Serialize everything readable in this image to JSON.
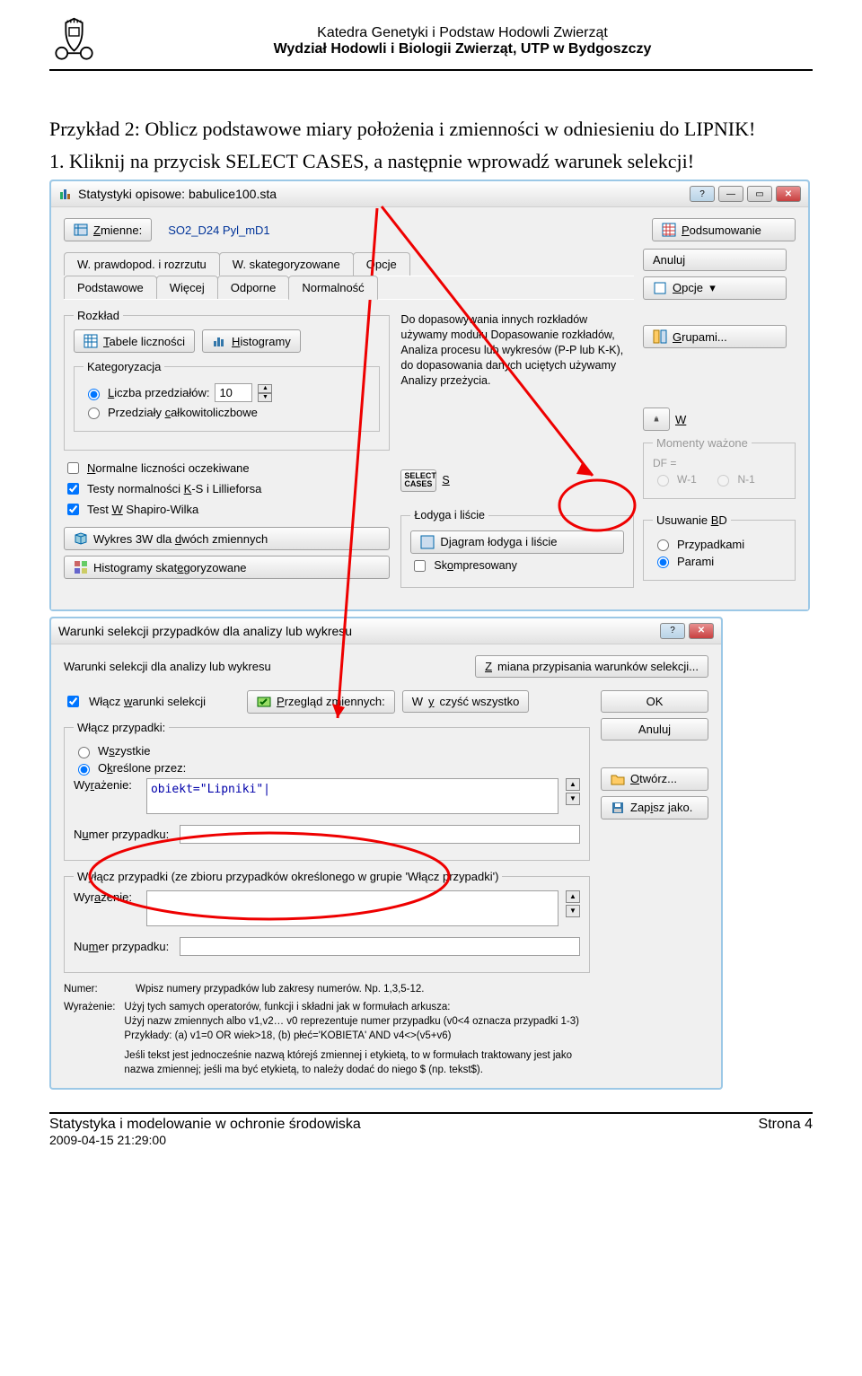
{
  "header": {
    "dept": "Katedra Genetyki i Podstaw Hodowli Zwierząt",
    "faculty": "Wydział Hodowli i Biologii Zwierząt, UTP w Bydgoszczy"
  },
  "body": {
    "p1": "Przykład 2: Oblicz podstawowe miary położenia i zmienności w odniesieniu do LIPNIK!",
    "p2": "1. Kliknij na przycisk SELECT CASES, a następnie wprowadź warunek selekcji!"
  },
  "dialog1": {
    "title": "Statystyki opisowe: babulice100.sta",
    "vars_label": "Zmienne:",
    "vars_value": "SO2_D24 Pyl_mD1",
    "btn_summary": "Podsumowanie",
    "btn_cancel": "Anuluj",
    "btn_options": "Opcje",
    "btn_groups": "Grupami...",
    "tabs_row1": [
      "W. prawdopod. i rozrzutu",
      "W. skategoryzowane",
      "Opcje"
    ],
    "tabs_row2": [
      "Podstawowe",
      "Więcej",
      "Odporne",
      "Normalność"
    ],
    "distribution": {
      "legend": "Rozkład",
      "btn_tables": "Tabele liczności",
      "btn_hist": "Histogramy"
    },
    "categorization": {
      "legend": "Kategoryzacja",
      "opt_intervals": "Liczba przedziałów:",
      "intervals_value": "10",
      "opt_integer": "Przedziały całkowitoliczbowe"
    },
    "chk_expected": "Normalne liczności oczekiwane",
    "chk_ks": "Testy normalności K-S i Lillieforsa",
    "chk_sw": "Test W Shapiro-Wilka",
    "btn_3dplot": "Wykres 3W  dla dwóch zmiennych",
    "btn_cathist": "Histogramy skategoryzowane",
    "info_text": "Do dopasowywania innych rozkładów używamy modułu Dopasowanie rozkładów, Analiza procesu lub wykresów (P-P lub K-K), do dopasowania danych uciętych używamy Analizy przeżycia.",
    "stem": {
      "legend": "Łodyga i liście",
      "btn_diagram": "Djagram łodyga i liście",
      "chk_compressed": "Skompresowany"
    },
    "select_cases_label": "SELECT CASES",
    "select_cases_s": "S",
    "btn_w": "W",
    "weights_legend": "Momenty ważone",
    "df_legend": "DF =",
    "df_opt1": "W-1",
    "df_opt2": "N-1",
    "bd": {
      "legend": "Usuwanie BD",
      "opt_cases": "Przypadkami",
      "opt_pairs": "Parami"
    }
  },
  "dialog2": {
    "title": "Warunki selekcji przypadków dla analizy lub wykresu",
    "subtitle": "Warunki selekcji dla analizy lub wykresu",
    "btn_change": "Zmiana przypisania warunków selekcji...",
    "chk_enable": "Włącz warunki selekcji",
    "btn_preview_label": "Przegląd zmiennych:",
    "btn_clear": "Wyczyść wszystko",
    "btn_ok": "OK",
    "btn_cancel": "Anuluj",
    "btn_open": "Otwórz...",
    "btn_save": "Zapisz jako.",
    "include": {
      "legend": "Włącz przypadki:",
      "opt_all": "Wszystkie",
      "opt_specific": "Określone przez:",
      "lbl_expr": "Wyrażenie:",
      "expr_value": "obiekt=\"Lipniki\"|",
      "lbl_casenum": "Numer przypadku:"
    },
    "exclude": {
      "legend": "Wyłącz przypadki (ze zbioru przypadków określonego w grupie 'Włącz przypadki')",
      "lbl_expr": "Wyrażenie:",
      "lbl_casenum": "Numer przypadku:"
    },
    "help": {
      "lbl_num": "Numer:",
      "txt_num": "Wpisz numery przypadków lub zakresy numerów. Np. 1,3,5-12.",
      "lbl_expr": "Wyrażenie:",
      "txt_expr1": "Użyj tych samych operatorów, funkcji i składni jak w formułach arkusza:",
      "txt_expr2": "Użyj nazw zmiennych albo v1,v2…   v0 reprezentuje numer przypadku (v0<4 oznacza przypadki 1-3)",
      "txt_expr3": "Przykłady: (a) v1=0 OR wiek>18,   (b) płeć='KOBIETA' AND v4<>(v5+v6)",
      "txt_expr4": "Jeśli tekst jest jednocześnie nazwą którejś zmiennej i etykietą, to w formułach traktowany jest jako nazwa zmiennej; jeśli ma być etykietą, to należy dodać do niego $ (np. tekst$)."
    }
  },
  "footer": {
    "left": "Statystyka i modelowanie w ochronie środowiska",
    "right": "Strona 4",
    "date": "2009-04-15 21:29:00"
  }
}
